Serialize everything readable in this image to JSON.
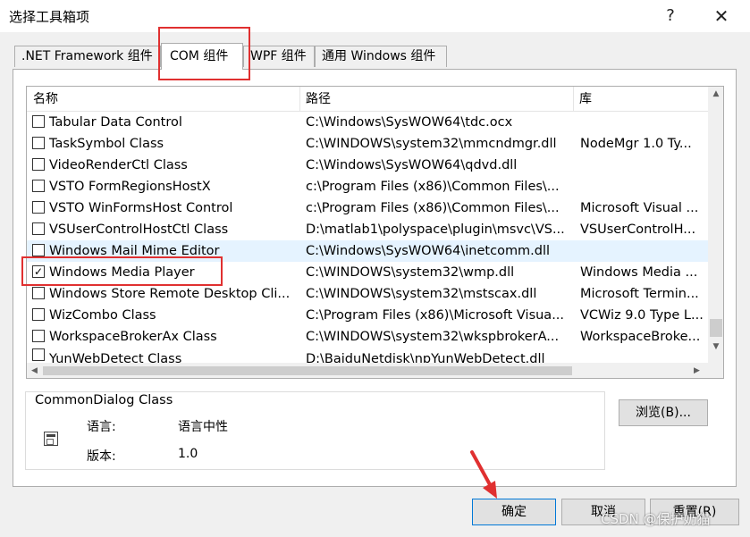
{
  "window": {
    "title": "选择工具箱项",
    "help_glyph": "?",
    "close_glyph": "✕"
  },
  "tabs": [
    {
      "label": ".NET Framework 组件",
      "active": false
    },
    {
      "label": "COM 组件",
      "active": true
    },
    {
      "label": "WPF 组件",
      "active": false
    },
    {
      "label": "通用 Windows 组件",
      "active": false
    }
  ],
  "list": {
    "columns": [
      "名称",
      "路径",
      "库"
    ],
    "rows": [
      {
        "name": "Tabular Data Control",
        "path": "C:\\Windows\\SysWOW64\\tdc.ocx",
        "lib": "",
        "checked": false
      },
      {
        "name": "TaskSymbol Class",
        "path": "C:\\WINDOWS\\system32\\mmcndmgr.dll",
        "lib": "NodeMgr 1.0 Ty...",
        "checked": false
      },
      {
        "name": "VideoRenderCtl Class",
        "path": "C:\\Windows\\SysWOW64\\qdvd.dll",
        "lib": "",
        "checked": false
      },
      {
        "name": "VSTO FormRegionsHostX",
        "path": "c:\\Program Files (x86)\\Common Files\\...",
        "lib": "",
        "checked": false
      },
      {
        "name": "VSTO WinFormsHost Control",
        "path": "c:\\Program Files (x86)\\Common Files\\...",
        "lib": "Microsoft Visual ...",
        "checked": false
      },
      {
        "name": "VSUserControlHostCtl Class",
        "path": "D:\\matlab1\\polyspace\\plugin\\msvc\\VS...",
        "lib": "VSUserControlH...",
        "checked": false
      },
      {
        "name": "Windows Mail Mime Editor",
        "path": "C:\\Windows\\SysWOW64\\inetcomm.dll",
        "lib": "",
        "checked": false
      },
      {
        "name": "Windows Media Player",
        "path": "C:\\WINDOWS\\system32\\wmp.dll",
        "lib": "Windows Media ...",
        "checked": true
      },
      {
        "name": "Windows Store Remote Desktop Cli...",
        "path": "C:\\WINDOWS\\system32\\mstscax.dll",
        "lib": "Microsoft Termin...",
        "checked": false
      },
      {
        "name": "WizCombo Class",
        "path": "C:\\Program Files (x86)\\Microsoft Visua...",
        "lib": "VCWiz 9.0 Type L...",
        "checked": false
      },
      {
        "name": "WorkspaceBrokerAx Class",
        "path": "C:\\WINDOWS\\system32\\wkspbrokerA...",
        "lib": "WorkspaceBroke...",
        "checked": false
      },
      {
        "name": "YunWebDetect Class",
        "path": "D:\\BaiduNetdisk\\npYunWebDetect.dll",
        "lib": "",
        "checked": false
      }
    ],
    "scroll_up_glyph": "▲",
    "scroll_down_glyph": "▼",
    "scroll_left_glyph": "◀",
    "scroll_right_glyph": "▶"
  },
  "info": {
    "component_name": "CommonDialog Class",
    "language_label": "语言:",
    "language_value": "语言中性",
    "version_label": "版本:",
    "version_value": "1.0"
  },
  "buttons": {
    "browse": "浏览(B)...",
    "ok": "确定",
    "cancel": "取消",
    "reset": "重置(R)"
  },
  "watermark": "CSDN @保护奶猫",
  "colors": {
    "annotation_red": "#e03030",
    "hover_row": "#e5f3ff",
    "focus_blue": "#0078d7"
  }
}
